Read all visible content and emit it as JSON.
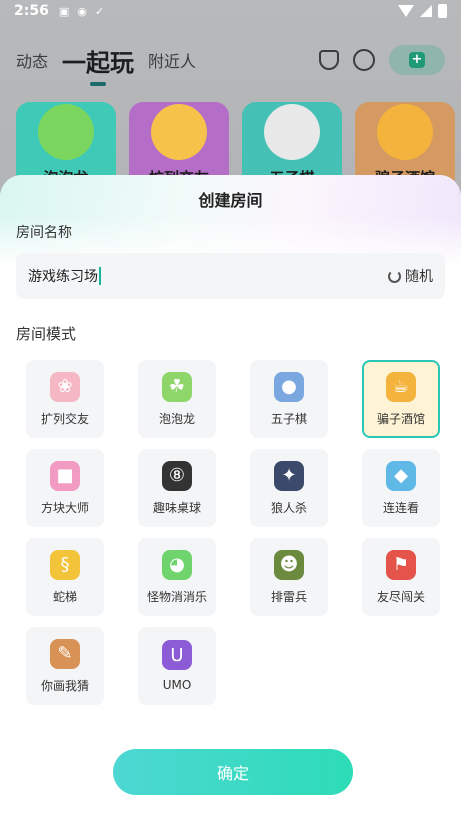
{
  "status_bar": {
    "time": "2:56"
  },
  "top_tabs": [
    "动态",
    "一起玩",
    "附近人"
  ],
  "game_cards": [
    {
      "label": "泡泡龙",
      "color": "#3fc9b7"
    },
    {
      "label": "扩列交友",
      "color": "#b46ec8"
    },
    {
      "label": "五子棋",
      "color": "#44c0b4"
    },
    {
      "label": "骗子酒馆",
      "color": "#d59a62"
    }
  ],
  "sheet": {
    "title": "创建房间",
    "room_name_label": "房间名称",
    "room_name_value": "游戏练习场",
    "random_label": "随机",
    "room_mode_label": "房间模式",
    "confirm_label": "确定"
  },
  "modes": [
    {
      "label": "扩列交友",
      "icon": "cute-blob-icon",
      "icon_color": "#f5b7c4",
      "selected": false
    },
    {
      "label": "泡泡龙",
      "icon": "dragon-icon",
      "icon_color": "#8fd66a",
      "selected": false
    },
    {
      "label": "五子棋",
      "icon": "gomoku-icon",
      "icon_color": "#7aa7e0",
      "selected": false
    },
    {
      "label": "骗子酒馆",
      "icon": "beer-icon",
      "icon_color": "#f3b33d",
      "selected": true
    },
    {
      "label": "方块大师",
      "icon": "cube-icon",
      "icon_color": "#f29cc3",
      "selected": false
    },
    {
      "label": "趣味桌球",
      "icon": "billiard-icon",
      "icon_color": "#333333",
      "selected": false
    },
    {
      "label": "狼人杀",
      "icon": "wolf-icon",
      "icon_color": "#3b4a6b",
      "selected": false
    },
    {
      "label": "连连看",
      "icon": "match-icon",
      "icon_color": "#5fb8e6",
      "selected": false
    },
    {
      "label": "蛇梯",
      "icon": "snake-icon",
      "icon_color": "#f3c33a",
      "selected": false
    },
    {
      "label": "怪物消消乐",
      "icon": "monster-icon",
      "icon_color": "#6fd46b",
      "selected": false
    },
    {
      "label": "排雷兵",
      "icon": "soldier-icon",
      "icon_color": "#6b8a3e",
      "selected": false
    },
    {
      "label": "友尽闯关",
      "icon": "flag-icon",
      "icon_color": "#e5544b",
      "selected": false
    },
    {
      "label": "你画我猜",
      "icon": "palette-icon",
      "icon_color": "#d99255",
      "selected": false
    },
    {
      "label": "UMO",
      "icon": "uno-card-icon",
      "icon_color": "#8c5bd6",
      "selected": false
    }
  ]
}
